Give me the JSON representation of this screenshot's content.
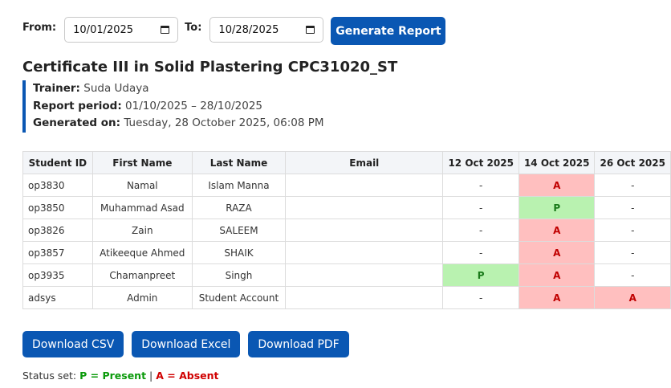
{
  "filters": {
    "from_label": "From:",
    "from_value": "10/01/2025",
    "to_label": "To:",
    "to_value": "10/28/2025",
    "generate_label": "Generate Report"
  },
  "report": {
    "title": "Certificate III in Solid Plastering CPC31020_ST",
    "trainer_label": "Trainer:",
    "trainer_value": "Suda Udaya",
    "period_label": "Report period:",
    "period_value": "01/10/2025 – 28/10/2025",
    "generated_label": "Generated on:",
    "generated_value": "Tuesday, 28 October 2025, 06:08 PM"
  },
  "table": {
    "columns": [
      "Student ID",
      "First Name",
      "Last Name",
      "Email",
      "12 Oct 2025",
      "14 Oct 2025",
      "26 Oct 2025"
    ],
    "rows": [
      {
        "id": "op3830",
        "first": "Namal",
        "last": "Islam Manna",
        "email": "",
        "d1": "-",
        "d2": "A",
        "d3": "-"
      },
      {
        "id": "op3850",
        "first": "Muhammad Asad",
        "last": "RAZA",
        "email": "",
        "d1": "-",
        "d2": "P",
        "d3": "-"
      },
      {
        "id": "op3826",
        "first": "Zain",
        "last": "SALEEM",
        "email": "",
        "d1": "-",
        "d2": "A",
        "d3": "-"
      },
      {
        "id": "op3857",
        "first": "Atikeeque Ahmed",
        "last": "SHAIK",
        "email": "",
        "d1": "-",
        "d2": "A",
        "d3": "-"
      },
      {
        "id": "op3935",
        "first": "Chamanpreet",
        "last": "Singh",
        "email": "",
        "d1": "P",
        "d2": "A",
        "d3": "-"
      },
      {
        "id": "adsys",
        "first": "Admin",
        "last": "Student Account",
        "email": "",
        "d1": "-",
        "d2": "A",
        "d3": "A"
      }
    ]
  },
  "downloads": {
    "csv": "Download CSV",
    "excel": "Download Excel",
    "pdf": "Download PDF"
  },
  "legend": {
    "prefix": "Status set:",
    "present": "P = Present",
    "separator": "|",
    "absent": "A = Absent"
  },
  "colors": {
    "accent": "#0a57b3",
    "absent_bg": "#ffbfbf",
    "present_bg": "#b9f2b0"
  }
}
